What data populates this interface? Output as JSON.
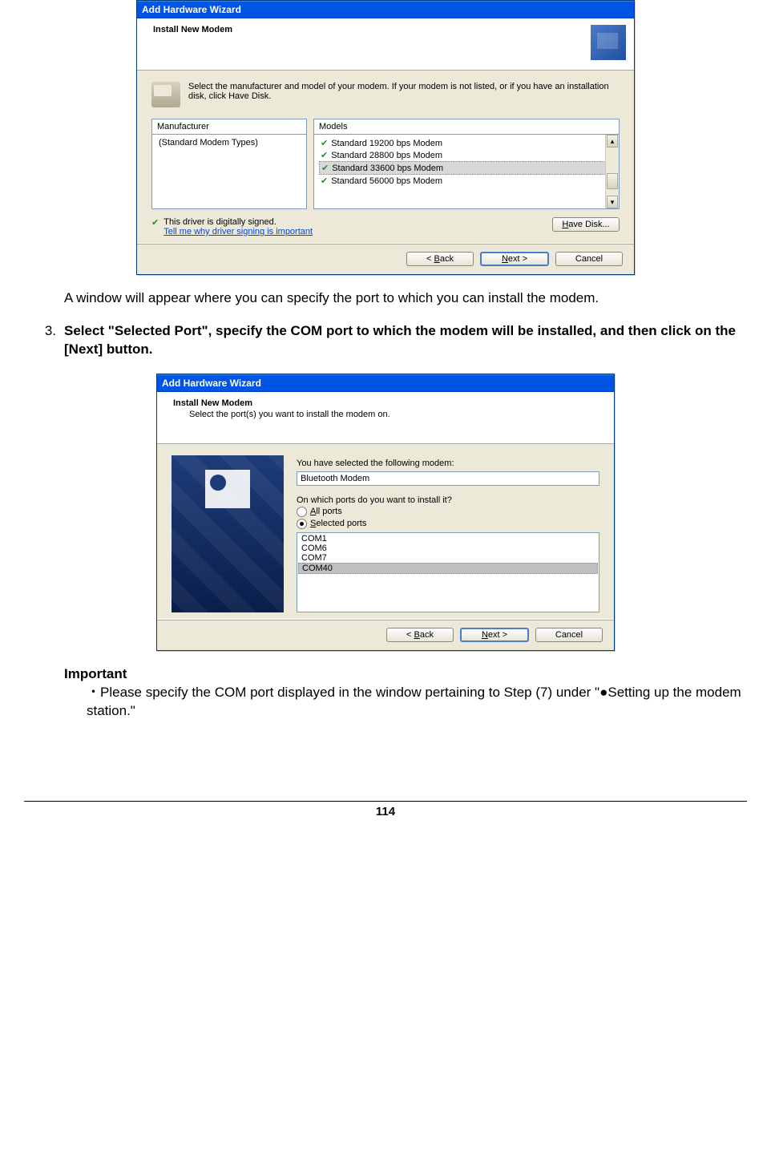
{
  "dialog1": {
    "title": "Add Hardware Wizard",
    "header_title": "Install New Modem",
    "instruction": "Select the manufacturer and model of your modem. If your modem is not listed, or if you have an installation disk, click Have Disk.",
    "manufacturer_header": "Manufacturer",
    "manufacturer_item": "(Standard Modem Types)",
    "models_header": "Models",
    "models": [
      "Standard 19200 bps Modem",
      "Standard 28800 bps Modem",
      "Standard 33600 bps Modem",
      "Standard 56000 bps Modem"
    ],
    "selected_model_index": 2,
    "signed_text": "This driver is digitally signed.",
    "signed_link": "Tell me why driver signing is important",
    "have_disk_btn": "Have Disk...",
    "back_btn": "< Back",
    "next_btn": "Next >",
    "cancel_btn": "Cancel"
  },
  "doc_para1": "A window will appear where you can specify the port to which you can install the modem.",
  "step3": {
    "num": "3.",
    "text": "Select \"Selected Port\", specify the COM port to which the modem will be installed, and then click on the [Next] button."
  },
  "dialog2": {
    "title": "Add Hardware Wizard",
    "header_title": "Install New Modem",
    "header_sub": "Select the port(s) you want to install the modem on.",
    "selected_label": "You have selected the following modem:",
    "selected_value": "Bluetooth Modem",
    "ports_question": "On which ports do you want to install it?",
    "radio_all": "All ports",
    "radio_selected": "Selected ports",
    "ports": [
      "COM1",
      "COM6",
      "COM7",
      "COM40"
    ],
    "selected_port_index": 3,
    "back_btn": "< Back",
    "next_btn": "Next >",
    "cancel_btn": "Cancel"
  },
  "important": {
    "heading": "Important",
    "body": "・Please specify the COM port displayed in the window pertaining to Step (7) under \"●Setting up the modem station.\""
  },
  "page_number": "114"
}
